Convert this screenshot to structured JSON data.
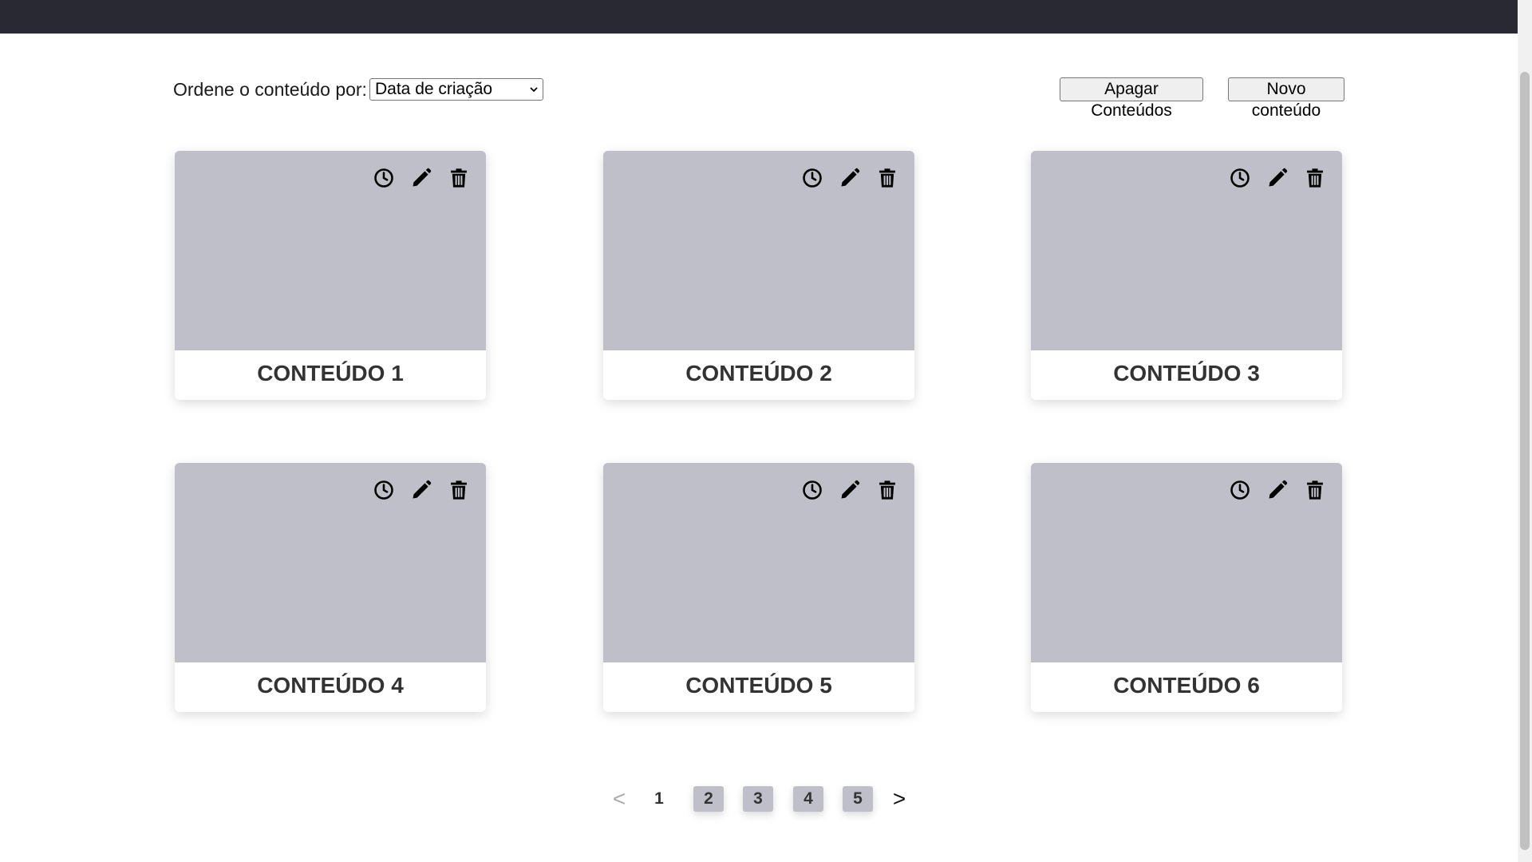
{
  "sort": {
    "label": "Ordene o conteúdo por:",
    "selected": "Data de criação"
  },
  "actions": {
    "delete_label": "Apagar Conteúdos",
    "new_label": "Novo conteúdo"
  },
  "cards": [
    {
      "title": "CONTEÚDO 1"
    },
    {
      "title": "CONTEÚDO 2"
    },
    {
      "title": "CONTEÚDO 3"
    },
    {
      "title": "CONTEÚDO 4"
    },
    {
      "title": "CONTEÚDO 5"
    },
    {
      "title": "CONTEÚDO 6"
    }
  ],
  "card_icons": [
    "clock-icon",
    "pencil-icon",
    "trash-icon"
  ],
  "pagination": {
    "prev": "<",
    "next": ">",
    "pages": [
      "1",
      "2",
      "3",
      "4",
      "5"
    ],
    "current": "1"
  },
  "colors": {
    "topbar": "#292933",
    "thumbnail": "#bfbfc9",
    "page_button": "#bfbfc9"
  }
}
